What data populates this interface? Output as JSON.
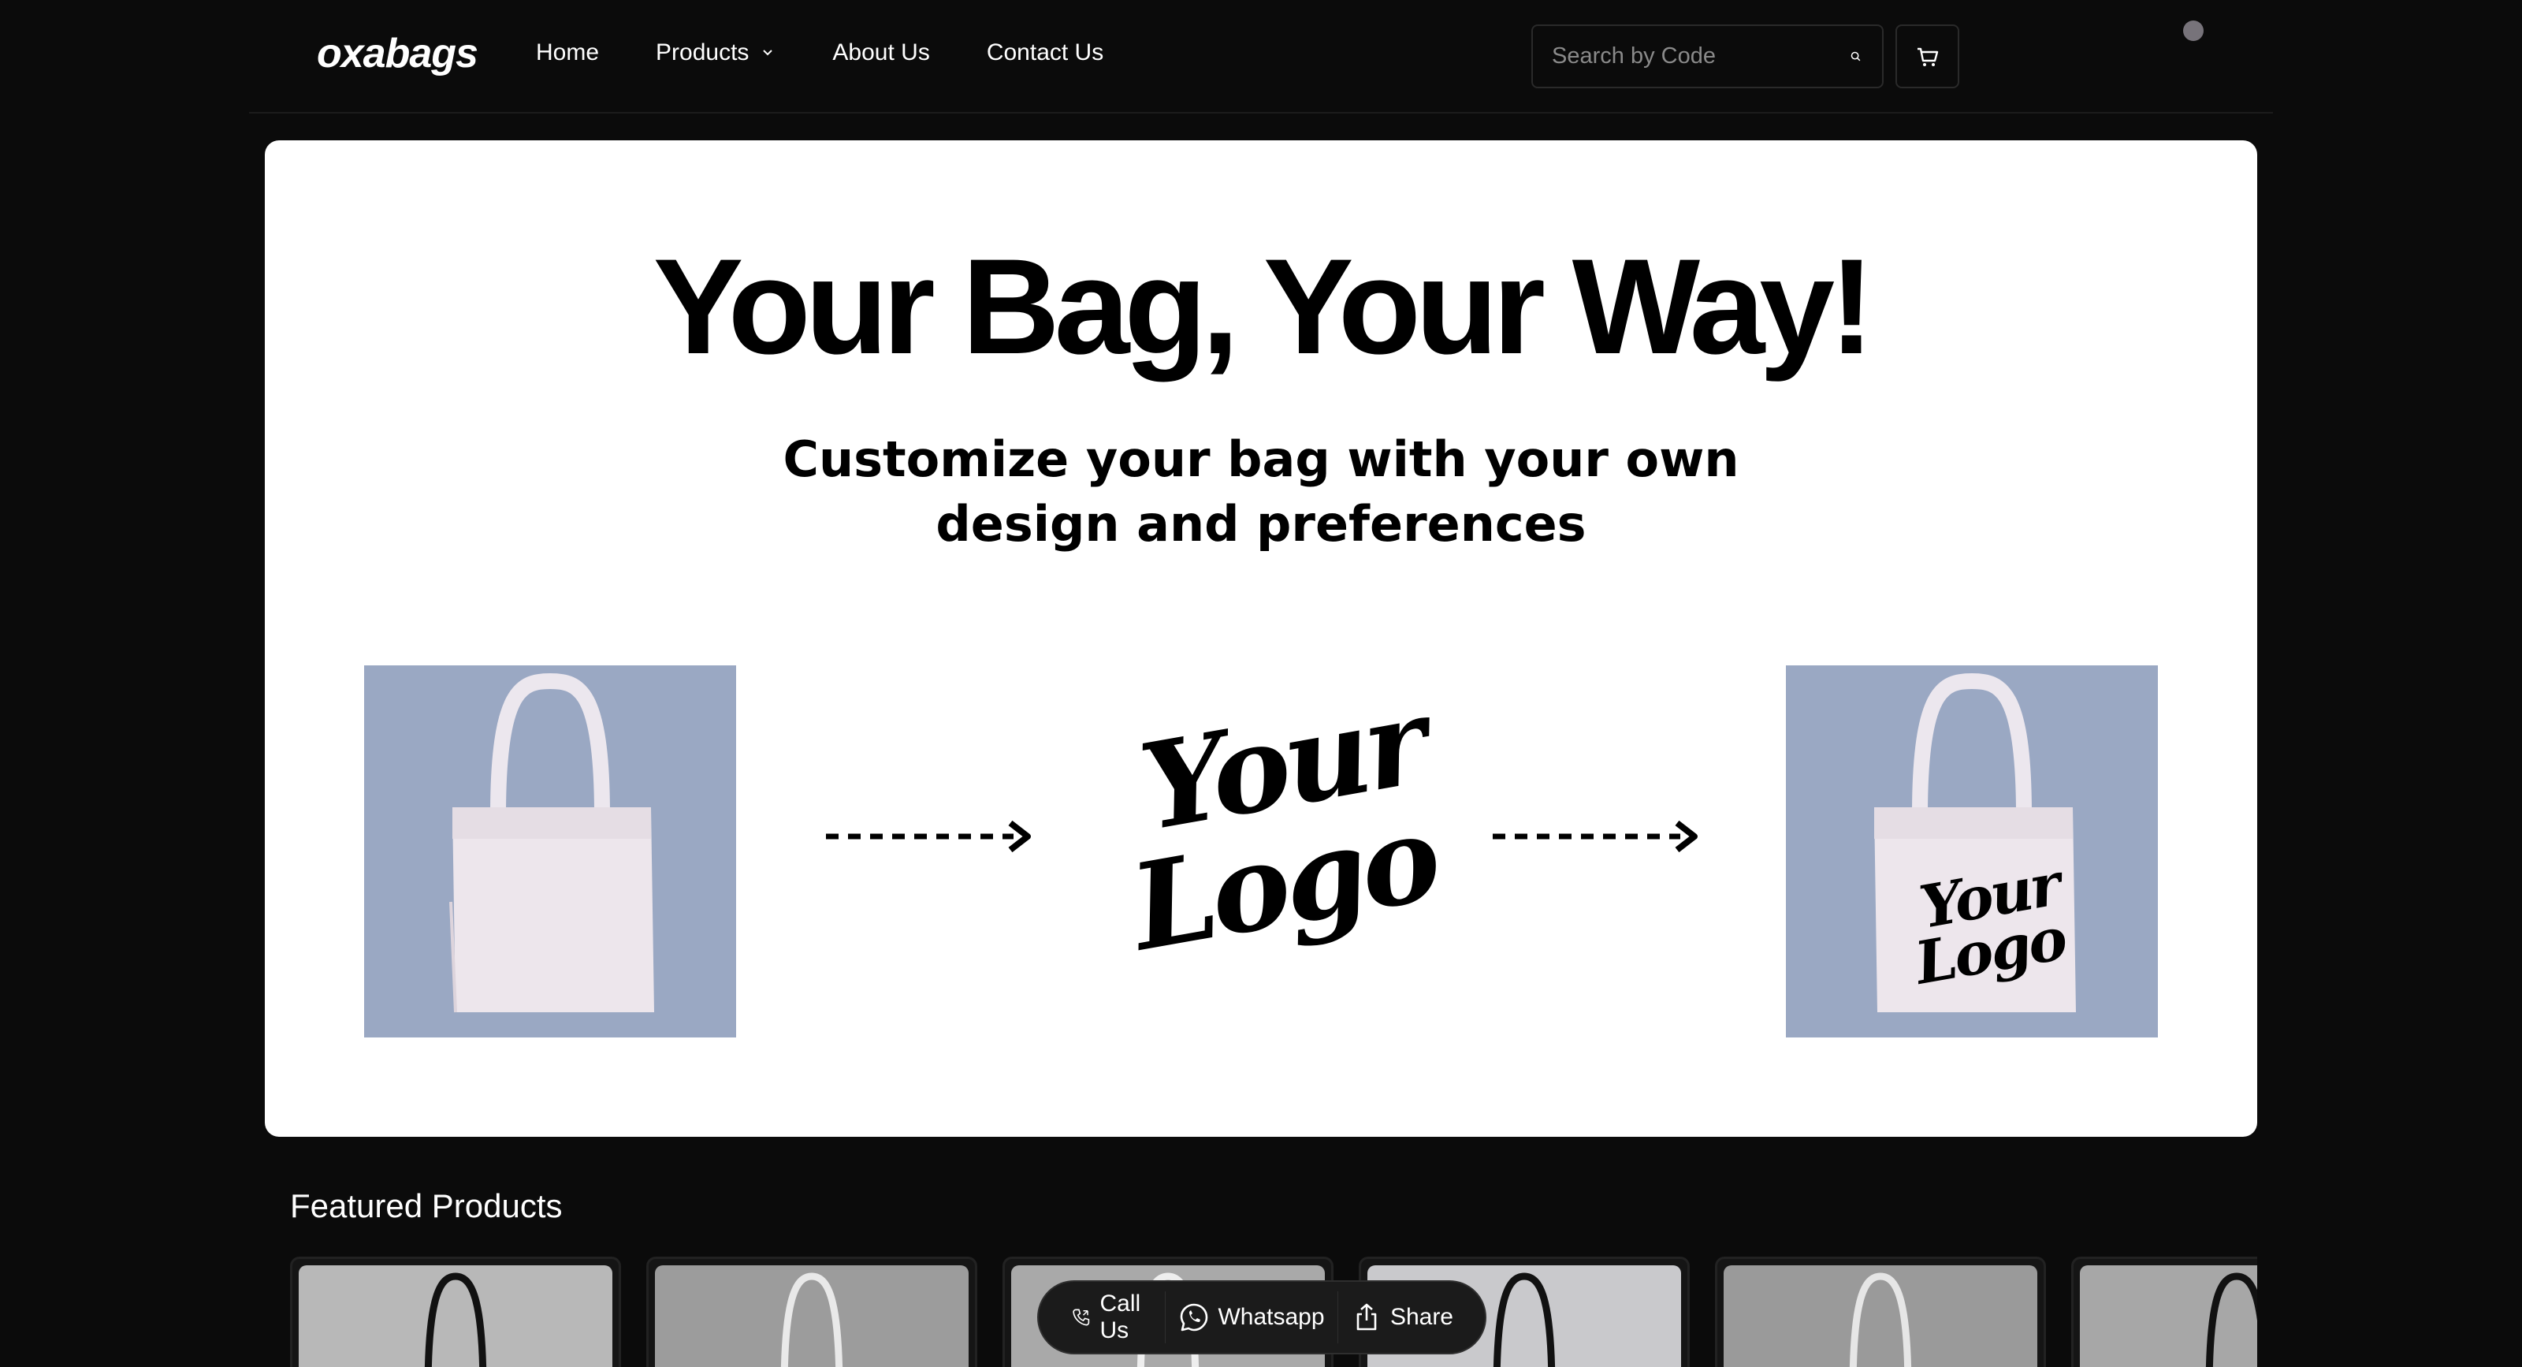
{
  "header": {
    "brand": "oxabags",
    "nav": [
      "Home",
      "Products",
      "About Us",
      "Contact Us"
    ],
    "search_placeholder": "Search by Code"
  },
  "banner": {
    "title": "Your Bag, Your Way!",
    "subtitle_line1": "Customize your bag with your own",
    "subtitle_line2": "design and preferences",
    "logo_line1": "Your",
    "logo_line2": "Logo"
  },
  "featured": {
    "title": "Featured Products",
    "products": [
      {
        "name": "black-tote",
        "bg": "#b8b8b8",
        "bag": "#111111"
      },
      {
        "name": "white-tote",
        "bg": "#9c9c9c",
        "bag": "#e9e9e9"
      },
      {
        "name": "white-tote",
        "bg": "#a9a9a9",
        "bag": "#eeeeee"
      },
      {
        "name": "black-tote",
        "bg": "#c9c9cc",
        "bag": "#111111"
      },
      {
        "name": "white-tote",
        "bg": "#9a9a9a",
        "bag": "#e6e6e6"
      },
      {
        "name": "black-tote",
        "bg": "#a7a7a7",
        "bag": "#111111"
      }
    ]
  },
  "float_bar": {
    "call": "Call Us",
    "whatsapp": "Whatsapp",
    "share": "Share"
  },
  "colors": {
    "page_bg": "#0b0b0b",
    "banner_bg": "#ffffff",
    "bag_card_bg": "#9aa8c3",
    "cart_dot": "#77737a"
  }
}
